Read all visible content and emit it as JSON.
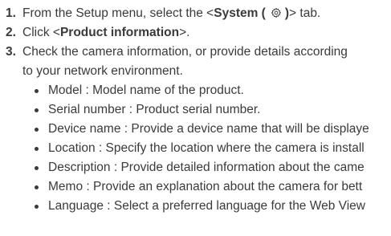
{
  "steps": [
    {
      "number": "1.",
      "text_before": "From the Setup menu, select the <",
      "bold_label": "System (",
      "icon": "gear-icon",
      "bold_close": ")",
      "text_after": "> tab."
    },
    {
      "number": "2.",
      "text_before": "Click <",
      "bold_label": "Product information",
      "text_after": ">."
    },
    {
      "number": "3.",
      "line1": "Check the camera information, or provide details according",
      "line2": "to your network environment.",
      "bullets": [
        "Model : Model name of the product.",
        "Serial number : Product serial number.",
        "Device name : Provide a device name that will be displaye",
        "Location : Specify the location where the camera is install",
        "Description : Provide detailed information about the came",
        "Memo : Provide an explanation about the camera for bett",
        "Language : Select a preferred language for the Web View"
      ]
    }
  ]
}
